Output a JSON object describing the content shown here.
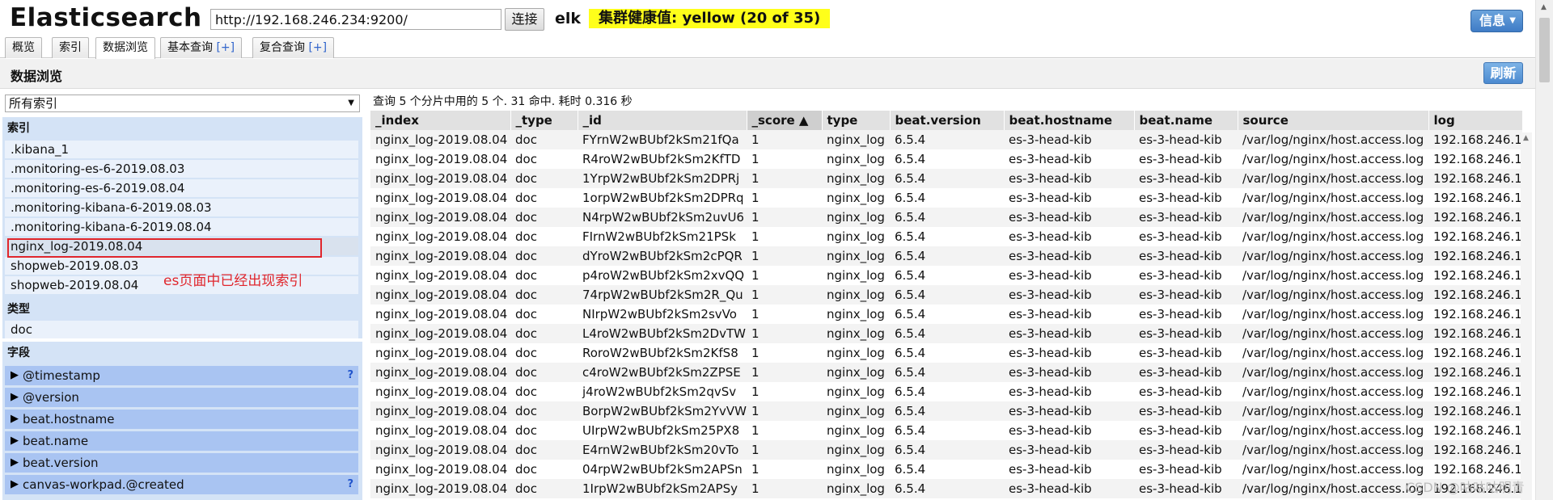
{
  "header": {
    "title": "Elasticsearch",
    "url_value": "http://192.168.246.234:9200/",
    "connect_label": "连接",
    "cluster_name": "elk",
    "health": "集群健康值: yellow (20 of 35)",
    "info_label": "信息"
  },
  "tabs": [
    {
      "label": "概览"
    },
    {
      "label": "索引"
    },
    {
      "label": "数据浏览"
    },
    {
      "label": "基本查询",
      "plus": "[+]"
    },
    {
      "label": "复合查询",
      "plus": "[+]"
    }
  ],
  "page": {
    "title": "数据浏览",
    "refresh_label": "刷新"
  },
  "sidebar": {
    "select_value": "所有索引",
    "index_label": "索引",
    "indices": [
      ".kibana_1",
      ".monitoring-es-6-2019.08.03",
      ".monitoring-es-6-2019.08.04",
      ".monitoring-kibana-6-2019.08.03",
      ".monitoring-kibana-6-2019.08.04",
      "nginx_log-2019.08.04",
      "shopweb-2019.08.03",
      "shopweb-2019.08.04"
    ],
    "annotation": "es页面中已经出现索引",
    "type_label": "类型",
    "types": [
      "doc"
    ],
    "field_label": "字段",
    "fields": [
      {
        "name": "@timestamp",
        "help": "?"
      },
      {
        "name": "@version",
        "help": ""
      },
      {
        "name": "beat.hostname",
        "help": ""
      },
      {
        "name": "beat.name",
        "help": ""
      },
      {
        "name": "beat.version",
        "help": ""
      },
      {
        "name": "canvas-workpad.@created",
        "help": "?"
      }
    ]
  },
  "results": {
    "summary": "查询 5 个分片中用的 5 个. 31 命中. 耗时 0.316 秒",
    "columns": [
      "_index",
      "_type",
      "_id",
      "_score ▲",
      "type",
      "beat.version",
      "beat.hostname",
      "beat.name",
      "source",
      "log"
    ],
    "rows": [
      [
        "nginx_log-2019.08.04",
        "doc",
        "FYrnW2wBUbf2kSm21fQa",
        "1",
        "nginx_log",
        "6.5.4",
        "es-3-head-kib",
        "es-3-head-kib",
        "/var/log/nginx/host.access.log",
        "192.168.246.1"
      ],
      [
        "nginx_log-2019.08.04",
        "doc",
        "R4roW2wBUbf2kSm2KfTD",
        "1",
        "nginx_log",
        "6.5.4",
        "es-3-head-kib",
        "es-3-head-kib",
        "/var/log/nginx/host.access.log",
        "192.168.246.1"
      ],
      [
        "nginx_log-2019.08.04",
        "doc",
        "1YrpW2wBUbf2kSm2DPRj",
        "1",
        "nginx_log",
        "6.5.4",
        "es-3-head-kib",
        "es-3-head-kib",
        "/var/log/nginx/host.access.log",
        "192.168.246.1"
      ],
      [
        "nginx_log-2019.08.04",
        "doc",
        "1orpW2wBUbf2kSm2DPRq",
        "1",
        "nginx_log",
        "6.5.4",
        "es-3-head-kib",
        "es-3-head-kib",
        "/var/log/nginx/host.access.log",
        "192.168.246.1"
      ],
      [
        "nginx_log-2019.08.04",
        "doc",
        "N4rpW2wBUbf2kSm2uvU6",
        "1",
        "nginx_log",
        "6.5.4",
        "es-3-head-kib",
        "es-3-head-kib",
        "/var/log/nginx/host.access.log",
        "192.168.246.1"
      ],
      [
        "nginx_log-2019.08.04",
        "doc",
        "FIrnW2wBUbf2kSm21PSk",
        "1",
        "nginx_log",
        "6.5.4",
        "es-3-head-kib",
        "es-3-head-kib",
        "/var/log/nginx/host.access.log",
        "192.168.246.1"
      ],
      [
        "nginx_log-2019.08.04",
        "doc",
        "dYroW2wBUbf2kSm2cPQR",
        "1",
        "nginx_log",
        "6.5.4",
        "es-3-head-kib",
        "es-3-head-kib",
        "/var/log/nginx/host.access.log",
        "192.168.246.1"
      ],
      [
        "nginx_log-2019.08.04",
        "doc",
        "p4roW2wBUbf2kSm2xvQQ",
        "1",
        "nginx_log",
        "6.5.4",
        "es-3-head-kib",
        "es-3-head-kib",
        "/var/log/nginx/host.access.log",
        "192.168.246.1"
      ],
      [
        "nginx_log-2019.08.04",
        "doc",
        "74rpW2wBUbf2kSm2R_Qu",
        "1",
        "nginx_log",
        "6.5.4",
        "es-3-head-kib",
        "es-3-head-kib",
        "/var/log/nginx/host.access.log",
        "192.168.246.1"
      ],
      [
        "nginx_log-2019.08.04",
        "doc",
        "NIrpW2wBUbf2kSm2svVo",
        "1",
        "nginx_log",
        "6.5.4",
        "es-3-head-kib",
        "es-3-head-kib",
        "/var/log/nginx/host.access.log",
        "192.168.246.1"
      ],
      [
        "nginx_log-2019.08.04",
        "doc",
        "L4roW2wBUbf2kSm2DvTW",
        "1",
        "nginx_log",
        "6.5.4",
        "es-3-head-kib",
        "es-3-head-kib",
        "/var/log/nginx/host.access.log",
        "192.168.246.1"
      ],
      [
        "nginx_log-2019.08.04",
        "doc",
        "RoroW2wBUbf2kSm2KfS8",
        "1",
        "nginx_log",
        "6.5.4",
        "es-3-head-kib",
        "es-3-head-kib",
        "/var/log/nginx/host.access.log",
        "192.168.246.1"
      ],
      [
        "nginx_log-2019.08.04",
        "doc",
        "c4roW2wBUbf2kSm2ZPSE",
        "1",
        "nginx_log",
        "6.5.4",
        "es-3-head-kib",
        "es-3-head-kib",
        "/var/log/nginx/host.access.log",
        "192.168.246.1"
      ],
      [
        "nginx_log-2019.08.04",
        "doc",
        "j4roW2wBUbf2kSm2qvSv",
        "1",
        "nginx_log",
        "6.5.4",
        "es-3-head-kib",
        "es-3-head-kib",
        "/var/log/nginx/host.access.log",
        "192.168.246.1"
      ],
      [
        "nginx_log-2019.08.04",
        "doc",
        "BorpW2wBUbf2kSm2YvVW",
        "1",
        "nginx_log",
        "6.5.4",
        "es-3-head-kib",
        "es-3-head-kib",
        "/var/log/nginx/host.access.log",
        "192.168.246.1"
      ],
      [
        "nginx_log-2019.08.04",
        "doc",
        "UIrpW2wBUbf2kSm25PX8",
        "1",
        "nginx_log",
        "6.5.4",
        "es-3-head-kib",
        "es-3-head-kib",
        "/var/log/nginx/host.access.log",
        "192.168.246.1"
      ],
      [
        "nginx_log-2019.08.04",
        "doc",
        "E4rnW2wBUbf2kSm20vTo",
        "1",
        "nginx_log",
        "6.5.4",
        "es-3-head-kib",
        "es-3-head-kib",
        "/var/log/nginx/host.access.log",
        "192.168.246.1"
      ],
      [
        "nginx_log-2019.08.04",
        "doc",
        "04rpW2wBUbf2kSm2APSn",
        "1",
        "nginx_log",
        "6.5.4",
        "es-3-head-kib",
        "es-3-head-kib",
        "/var/log/nginx/host.access.log",
        "192.168.246.1"
      ],
      [
        "nginx_log-2019.08.04",
        "doc",
        "1IrpW2wBUbf2kSm2APSy",
        "1",
        "nginx_log",
        "6.5.4",
        "es-3-head-kib",
        "es-3-head-kib",
        "/var/log/nginx/host.access.log",
        "192.168.246.1"
      ]
    ]
  },
  "watermark": "CSDN @咕咕咕明青"
}
